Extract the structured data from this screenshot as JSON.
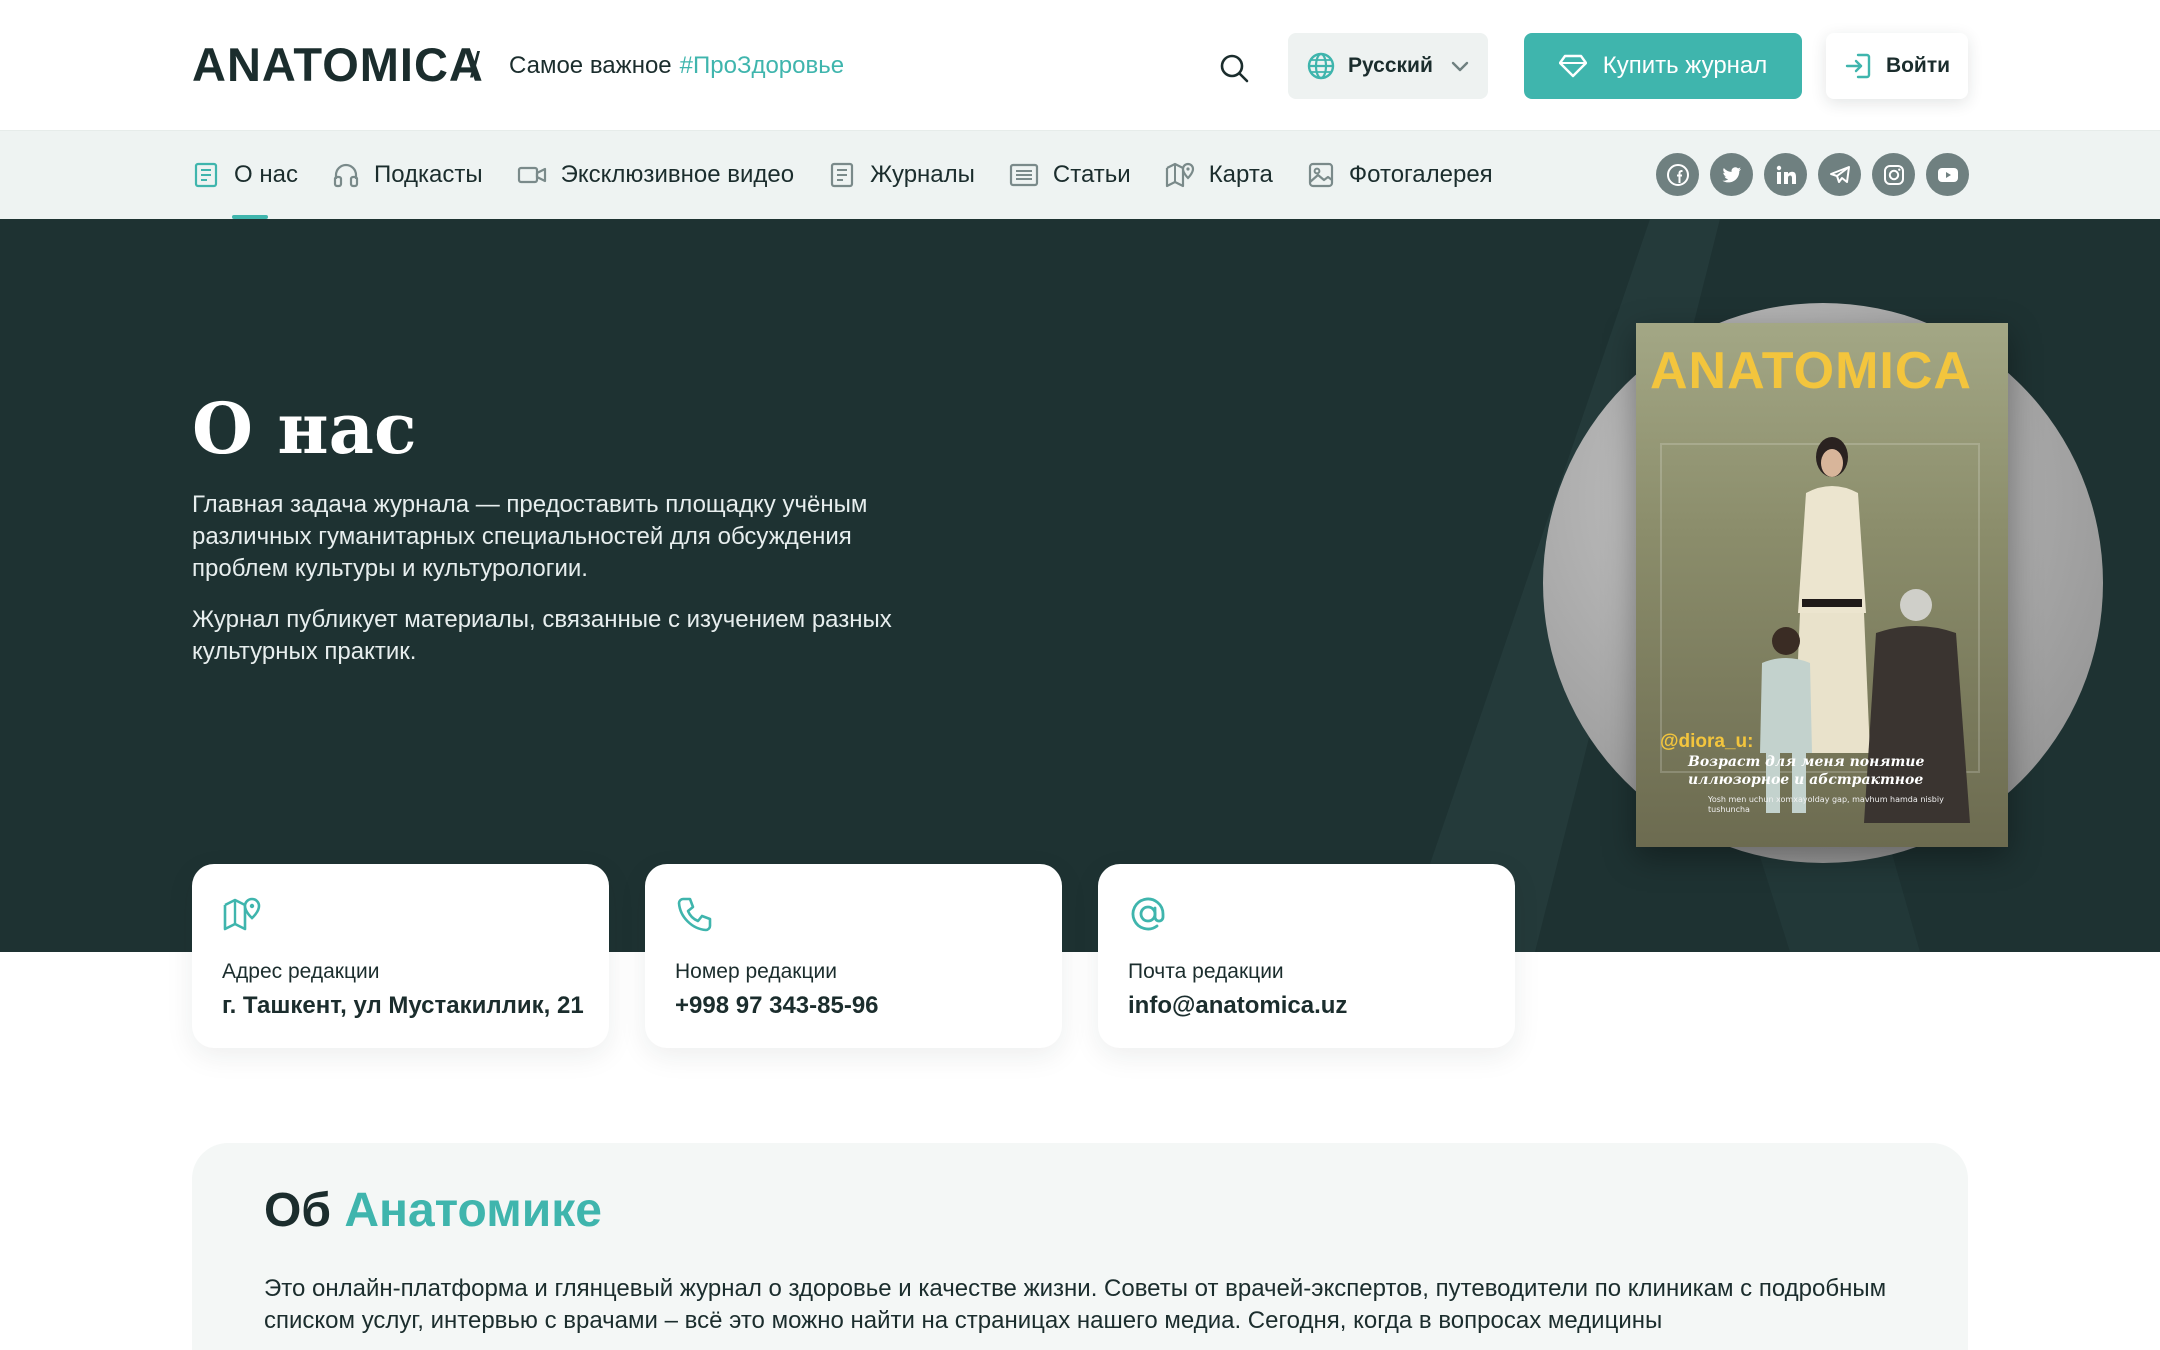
{
  "header": {
    "logo": "ANATOMICA",
    "separator": "/",
    "tagline": "Самое важное",
    "hashtag": "#ПроЗдоровье",
    "language": "Русский",
    "buy_label": "Купить журнал",
    "login_label": "Войти"
  },
  "nav": {
    "items": [
      {
        "label": "О нас",
        "icon": "document-icon",
        "active": true
      },
      {
        "label": "Подкасты",
        "icon": "headphones-icon"
      },
      {
        "label": "Эксклюзивное видео",
        "icon": "video-icon"
      },
      {
        "label": "Журналы",
        "icon": "magazine-icon"
      },
      {
        "label": "Статьи",
        "icon": "article-icon"
      },
      {
        "label": "Карта",
        "icon": "map-icon"
      },
      {
        "label": "Фотогалерея",
        "icon": "gallery-icon"
      }
    ],
    "social": [
      "facebook-icon",
      "twitter-icon",
      "linkedin-icon",
      "telegram-icon",
      "instagram-icon",
      "youtube-icon"
    ]
  },
  "hero": {
    "title": "О нас",
    "paragraph1": "Главная задача журнала — предоставить площадку учёным различных гуманитарных специальностей для обсуждения проблем культуры и культурологии.",
    "paragraph2": "Журнал публикует материалы, связанные с изучением разных культурных практик."
  },
  "cover": {
    "logo": "ANATOMICA",
    "handle": "@diora_u:",
    "quote": "Возраст для меня понятие иллюзорное и абстрактное",
    "subtitle": "Yosh men uchun xomxayolday gap, mavhum hamda nisbiy tushuncha"
  },
  "contacts": {
    "address": {
      "label": "Адрес редакции",
      "value": "г. Ташкент, ул Мустакиллик, 21"
    },
    "phone": {
      "label": "Номер редакции",
      "value": "+998 97 343-85-96"
    },
    "email": {
      "label": "Почта редакции",
      "value": "info@anatomica.uz"
    }
  },
  "about": {
    "title_prefix": "Об",
    "title_accent": "Анатомике",
    "text": "Это онлайн-платформа и глянцевый журнал о здоровье и качестве жизни. Советы от врачей-экспертов, путеводители по клиникам с подробным списком услуг, интервью с врачами – всё это можно найти на страницах нашего медиа. Сегодня, когда в вопросах медицины"
  },
  "colors": {
    "accent": "#3fb5ad",
    "dark": "#1e3232",
    "cover_logo": "#f3c53d"
  }
}
